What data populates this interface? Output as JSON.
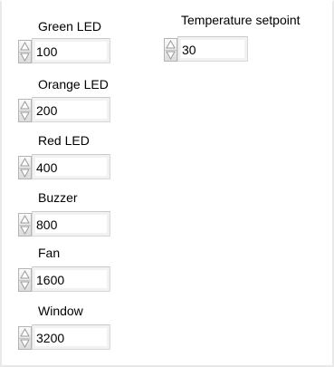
{
  "controls": [
    {
      "label": "Green LED",
      "value": "100"
    },
    {
      "label": "Orange LED",
      "value": "200"
    },
    {
      "label": "Red LED",
      "value": "400"
    },
    {
      "label": "Buzzer",
      "value": "800"
    },
    {
      "label": "Fan",
      "value": "1600"
    },
    {
      "label": "Window",
      "value": "3200"
    }
  ],
  "setpoint": {
    "label": "Temperature setpoint",
    "value": "30"
  },
  "icons": {
    "increment": "triangle-up-icon",
    "decrement": "triangle-down-icon"
  }
}
